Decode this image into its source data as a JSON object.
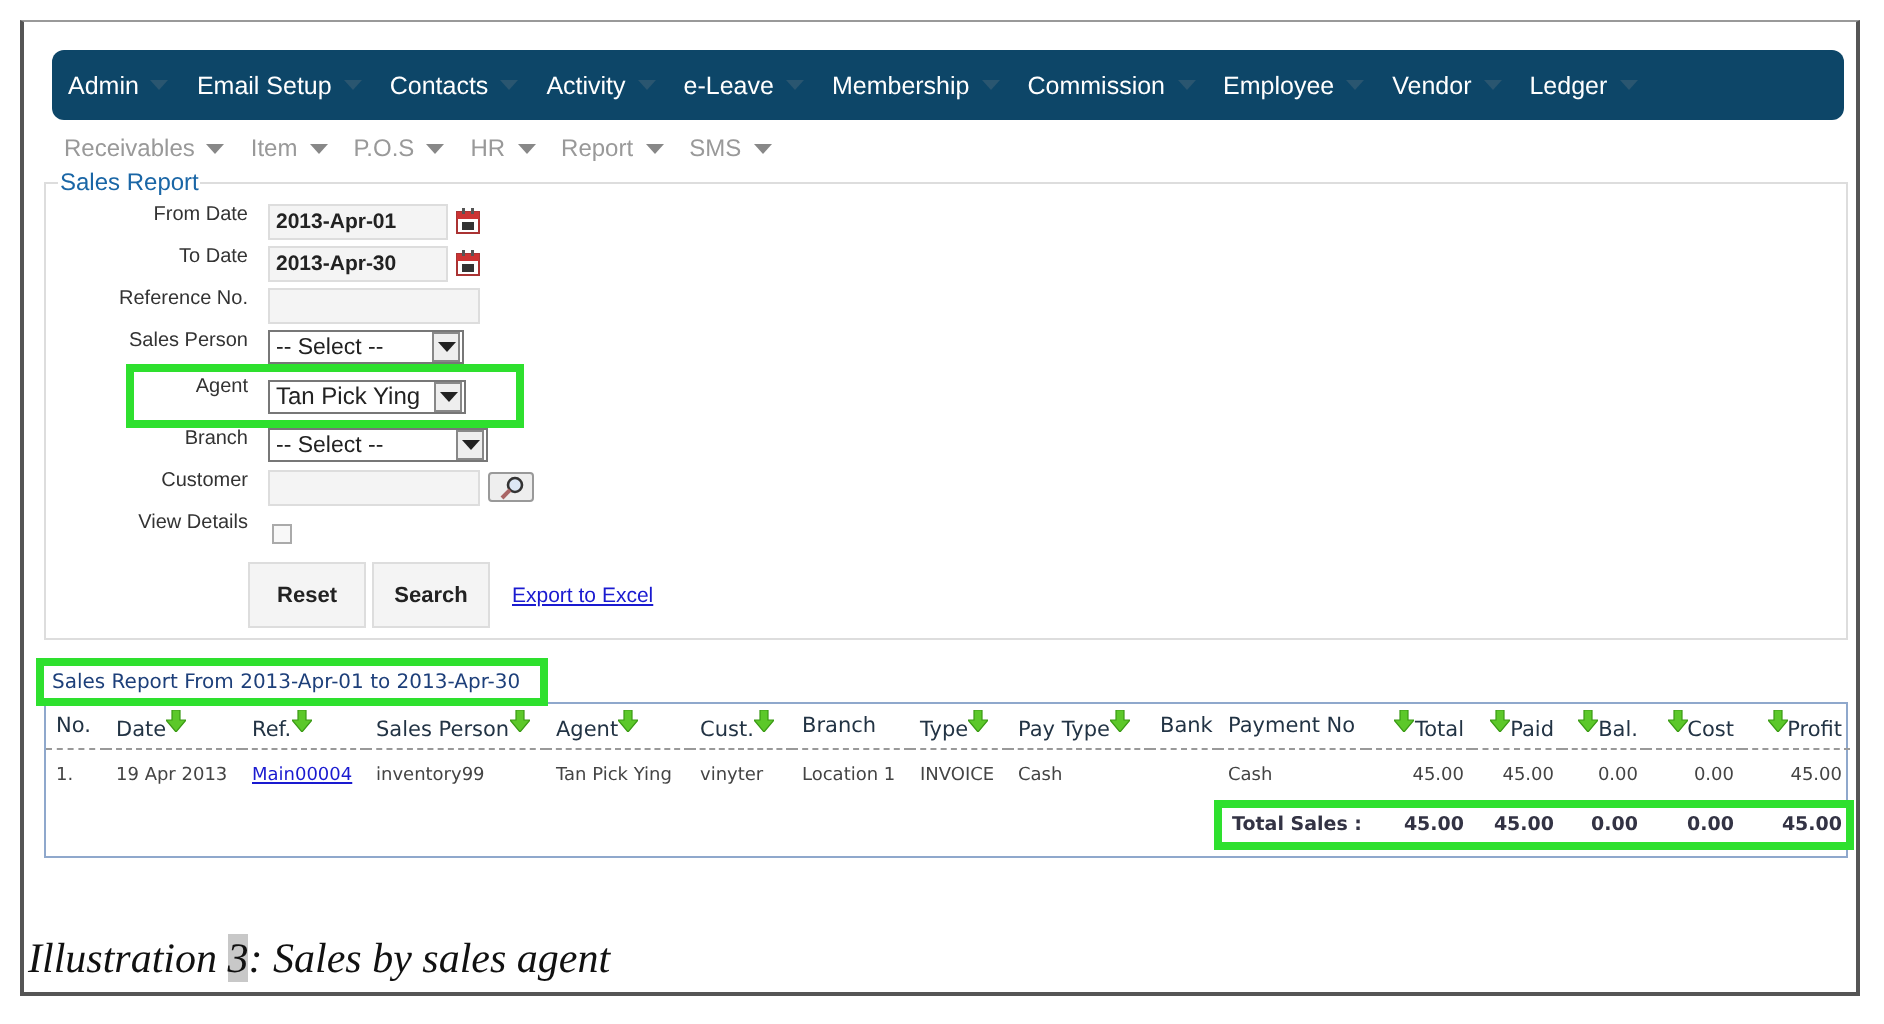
{
  "nav_menu": [
    {
      "label": "Admin"
    },
    {
      "label": "Email Setup"
    },
    {
      "label": "Contacts"
    },
    {
      "label": "Activity"
    },
    {
      "label": "e-Leave"
    },
    {
      "label": "Membership"
    },
    {
      "label": "Commission"
    },
    {
      "label": "Employee"
    },
    {
      "label": "Vendor"
    },
    {
      "label": "Ledger"
    }
  ],
  "sub_menu": [
    {
      "label": "Receivables"
    },
    {
      "label": "Item"
    },
    {
      "label": "P.O.S"
    },
    {
      "label": "HR"
    },
    {
      "label": "Report"
    },
    {
      "label": "SMS"
    }
  ],
  "form": {
    "legend": "Sales Report",
    "fields": [
      {
        "kind": "date",
        "label": "From Date",
        "value": "2013-Apr-01",
        "highlighted": false
      },
      {
        "kind": "date",
        "label": "To Date",
        "value": "2013-Apr-30",
        "highlighted": false
      },
      {
        "kind": "text",
        "label": "Reference No.",
        "highlighted": false
      },
      {
        "kind": "select",
        "label": "Sales Person",
        "value": "-- Select --",
        "highlighted": false
      },
      {
        "kind": "select",
        "label": "Agent",
        "value": "Tan Pick Ying",
        "highlighted": true
      },
      {
        "kind": "select",
        "label": "Branch",
        "value": "-- Select --",
        "highlighted": false
      },
      {
        "kind": "lookup",
        "label": "Customer",
        "highlighted": false
      },
      {
        "kind": "checkbox",
        "label": "View Details",
        "checked": false,
        "highlighted": false
      }
    ],
    "buttons": [
      {
        "label": "Reset"
      },
      {
        "label": "Search"
      }
    ],
    "export_link": "Export to Excel"
  },
  "result": {
    "title": "Sales Report From 2013-Apr-01 to 2013-Apr-30",
    "title_highlighted": true,
    "columns": [
      {
        "label": "No.",
        "sortable": false,
        "numeric": false
      },
      {
        "label": "Date",
        "sortable": true,
        "numeric": false
      },
      {
        "label": "Ref.",
        "sortable": true,
        "numeric": false
      },
      {
        "label": "Sales Person",
        "sortable": true,
        "numeric": false
      },
      {
        "label": "Agent",
        "sortable": true,
        "numeric": false
      },
      {
        "label": "Cust.",
        "sortable": true,
        "numeric": false
      },
      {
        "label": "Branch",
        "sortable": false,
        "numeric": false
      },
      {
        "label": "Type",
        "sortable": true,
        "numeric": false
      },
      {
        "label": "Pay Type",
        "sortable": true,
        "numeric": false
      },
      {
        "label": "Bank",
        "sortable": false,
        "numeric": false
      },
      {
        "label": "Payment No",
        "sortable": false,
        "numeric": false
      },
      {
        "label": "Total",
        "sortable": true,
        "numeric": true
      },
      {
        "label": "Paid",
        "sortable": true,
        "numeric": true
      },
      {
        "label": "Bal.",
        "sortable": true,
        "numeric": true
      },
      {
        "label": "Cost",
        "sortable": true,
        "numeric": true
      },
      {
        "label": "Profit",
        "sortable": true,
        "numeric": true
      }
    ],
    "rows": [
      {
        "cells": [
          "1.",
          "19 Apr 2013",
          "Main00004",
          "inventory99",
          "Tan Pick Ying",
          "vinyter",
          "Location 1",
          "INVOICE",
          "Cash",
          "",
          "Cash",
          "45.00",
          "45.00",
          "0.00",
          "0.00",
          "45.00"
        ]
      }
    ],
    "total": {
      "label": "Total Sales :",
      "values": [
        "45.00",
        "45.00",
        "0.00",
        "0.00",
        "45.00"
      ],
      "highlighted": true
    }
  },
  "caption": {
    "label": "Illustration",
    "number": "3",
    "text": ": Sales by sales agent"
  }
}
